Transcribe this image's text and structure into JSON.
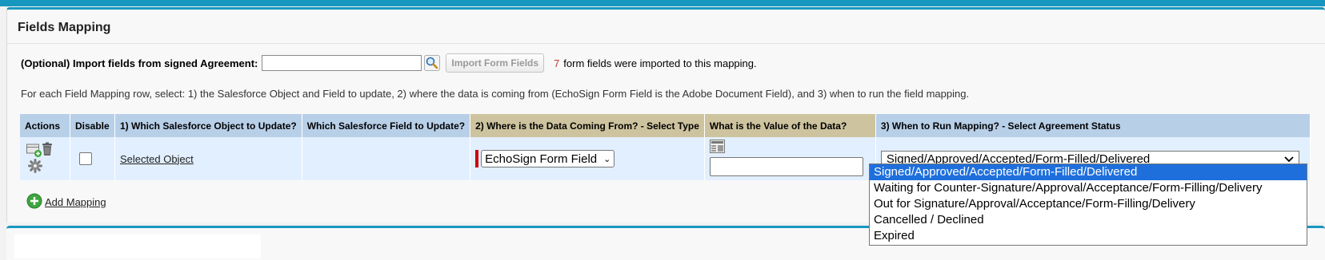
{
  "panel": {
    "title": "Fields Mapping"
  },
  "import": {
    "label": "(Optional) Import fields from signed Agreement:",
    "agreement_value": "",
    "button_label": "Import Form Fields",
    "count": "7",
    "message": "form fields were imported to this mapping."
  },
  "instructions": "For each Field Mapping row, select: 1) the Salesforce Object and Field to update, 2) where the data is coming from (EchoSign Form Field is the Adobe Document Field), and 3) when to run the field mapping.",
  "table": {
    "headers": [
      "Actions",
      "Disable",
      "1) Which Salesforce Object to Update?",
      "Which Salesforce Field to Update?",
      "2) Where is the Data Coming From? - Select Type",
      "What is the Value of the Data?",
      "3) When to Run Mapping? - Select Agreement Status"
    ],
    "row": {
      "disabled": false,
      "object_link": "Selected Object",
      "field": "",
      "source_type": "EchoSign Form Field",
      "value": "",
      "status": "Signed/Approved/Accepted/Form-Filled/Delivered"
    }
  },
  "add_mapping_label": "Add Mapping",
  "status_options": [
    "Signed/Approved/Accepted/Form-Filled/Delivered",
    "Waiting for Counter-Signature/Approval/Acceptance/Form-Filling/Delivery",
    "Out for Signature/Approval/Acceptance/Form-Filling/Delivery",
    "Cancelled / Declined",
    "Expired"
  ],
  "selected_option_index": 0,
  "icons": [
    "lookup-icon",
    "add-row-icon",
    "trash-icon",
    "gear-icon",
    "lookup-table-icon",
    "add-circle-icon",
    "chevron-down-icon"
  ],
  "colors": {
    "accent": "#1797c0",
    "header_blue": "#b8cfe8",
    "header_tan": "#cdc39e",
    "row_bg": "#e2efff",
    "highlight": "#1e6fdc",
    "required": "#cc0000",
    "count": "#c23934"
  }
}
